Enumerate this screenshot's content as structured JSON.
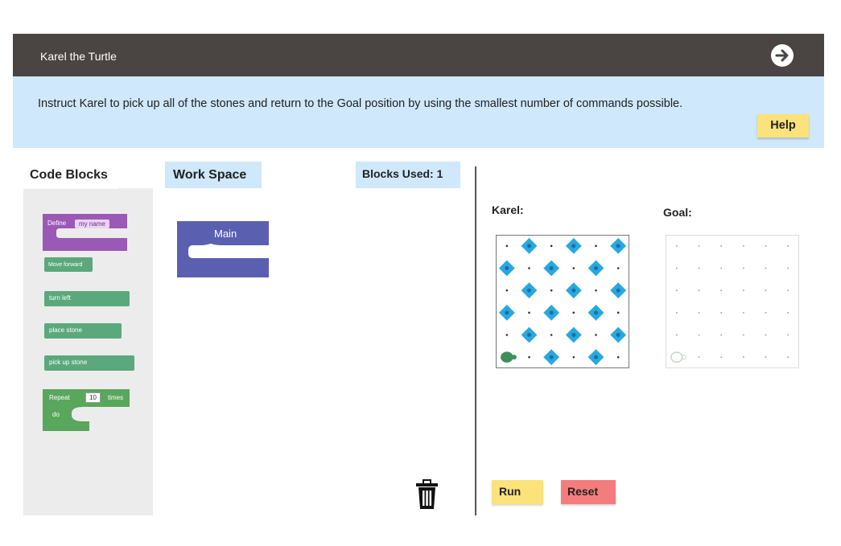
{
  "header": {
    "title": "Karel the Turtle",
    "next_icon": "arrow-right-circle-icon"
  },
  "instructions": {
    "text": "Instruct Karel to pick up all of the stones and return to the Goal position by using the smallest number of commands possible.",
    "help_label": "Help"
  },
  "palette": {
    "tab_label": "Code Blocks",
    "define_label": "Define",
    "define_name": "my name",
    "move_forward": "Move forward",
    "turn_left": "turn left",
    "place_stone": "place stone",
    "pick_up_stone": "pick up stone",
    "repeat_label": "Repeat",
    "repeat_count": "10",
    "repeat_times": "times",
    "repeat_do": "do"
  },
  "workspace": {
    "tab_label": "Work Space",
    "blocks_used": "Blocks Used: 1",
    "main_block": "Main",
    "trash_icon": "trash-icon"
  },
  "world": {
    "karel_label": "Karel:",
    "goal_label": "Goal:",
    "stone_color": "#29a8e0",
    "turtle_color": "#3f8f5a",
    "grid_size": 6,
    "karel_stones": [
      [
        0,
        1
      ],
      [
        0,
        3
      ],
      [
        0,
        5
      ],
      [
        1,
        0
      ],
      [
        1,
        2
      ],
      [
        1,
        4
      ],
      [
        2,
        1
      ],
      [
        2,
        3
      ],
      [
        2,
        5
      ],
      [
        3,
        0
      ],
      [
        3,
        2
      ],
      [
        3,
        4
      ],
      [
        4,
        1
      ],
      [
        4,
        3
      ],
      [
        4,
        5
      ],
      [
        5,
        2
      ],
      [
        5,
        4
      ]
    ],
    "karel_turtle": [
      5,
      0
    ],
    "goal_turtle": [
      5,
      0
    ]
  },
  "controls": {
    "run_label": "Run",
    "reset_label": "Reset"
  }
}
